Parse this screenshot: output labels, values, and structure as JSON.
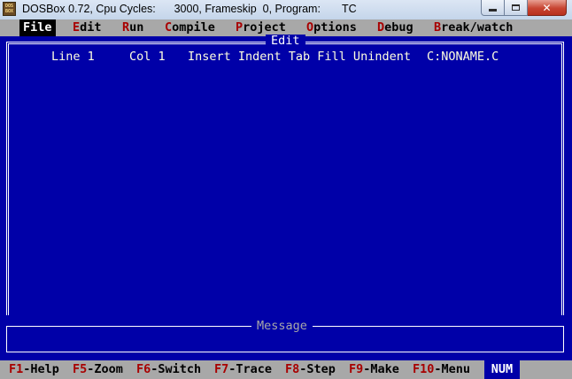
{
  "window": {
    "title": "DOSBox 0.72, Cpu Cycles:      3000, Frameskip  0, Program:       TC",
    "icon_label": "DOS BOX",
    "controls": {
      "minimize": "",
      "maximize": "",
      "close": "✕"
    }
  },
  "menu": [
    {
      "hot": "F",
      "rest": "ile",
      "active": true
    },
    {
      "hot": "E",
      "rest": "dit",
      "active": false
    },
    {
      "hot": "R",
      "rest": "un",
      "active": false
    },
    {
      "hot": "C",
      "rest": "ompile",
      "active": false
    },
    {
      "hot": "P",
      "rest": "roject",
      "active": false
    },
    {
      "hot": "O",
      "rest": "ptions",
      "active": false
    },
    {
      "hot": "D",
      "rest": "ebug",
      "active": false
    },
    {
      "hot": "B",
      "rest": "reak/watch",
      "active": false
    }
  ],
  "editor": {
    "title": "Edit",
    "status": {
      "line": "Line 1",
      "col": "Col 1",
      "modes": "Insert Indent Tab Fill Unindent",
      "file": "C:NONAME.C"
    }
  },
  "message": {
    "title": "Message"
  },
  "fkeys": [
    {
      "key": "F1",
      "label": "-Help"
    },
    {
      "key": "F5",
      "label": "-Zoom"
    },
    {
      "key": "F6",
      "label": "-Switch"
    },
    {
      "key": "F7",
      "label": "-Trace"
    },
    {
      "key": "F8",
      "label": "-Step"
    },
    {
      "key": "F9",
      "label": "-Make"
    },
    {
      "key": "F10",
      "label": "-Menu"
    }
  ],
  "num_indicator": "NUM",
  "colors": {
    "dos_blue": "#0000a8",
    "dos_gray": "#a8a8a8",
    "hotkey_red": "#a80000",
    "status_text": "#ffffe0"
  }
}
